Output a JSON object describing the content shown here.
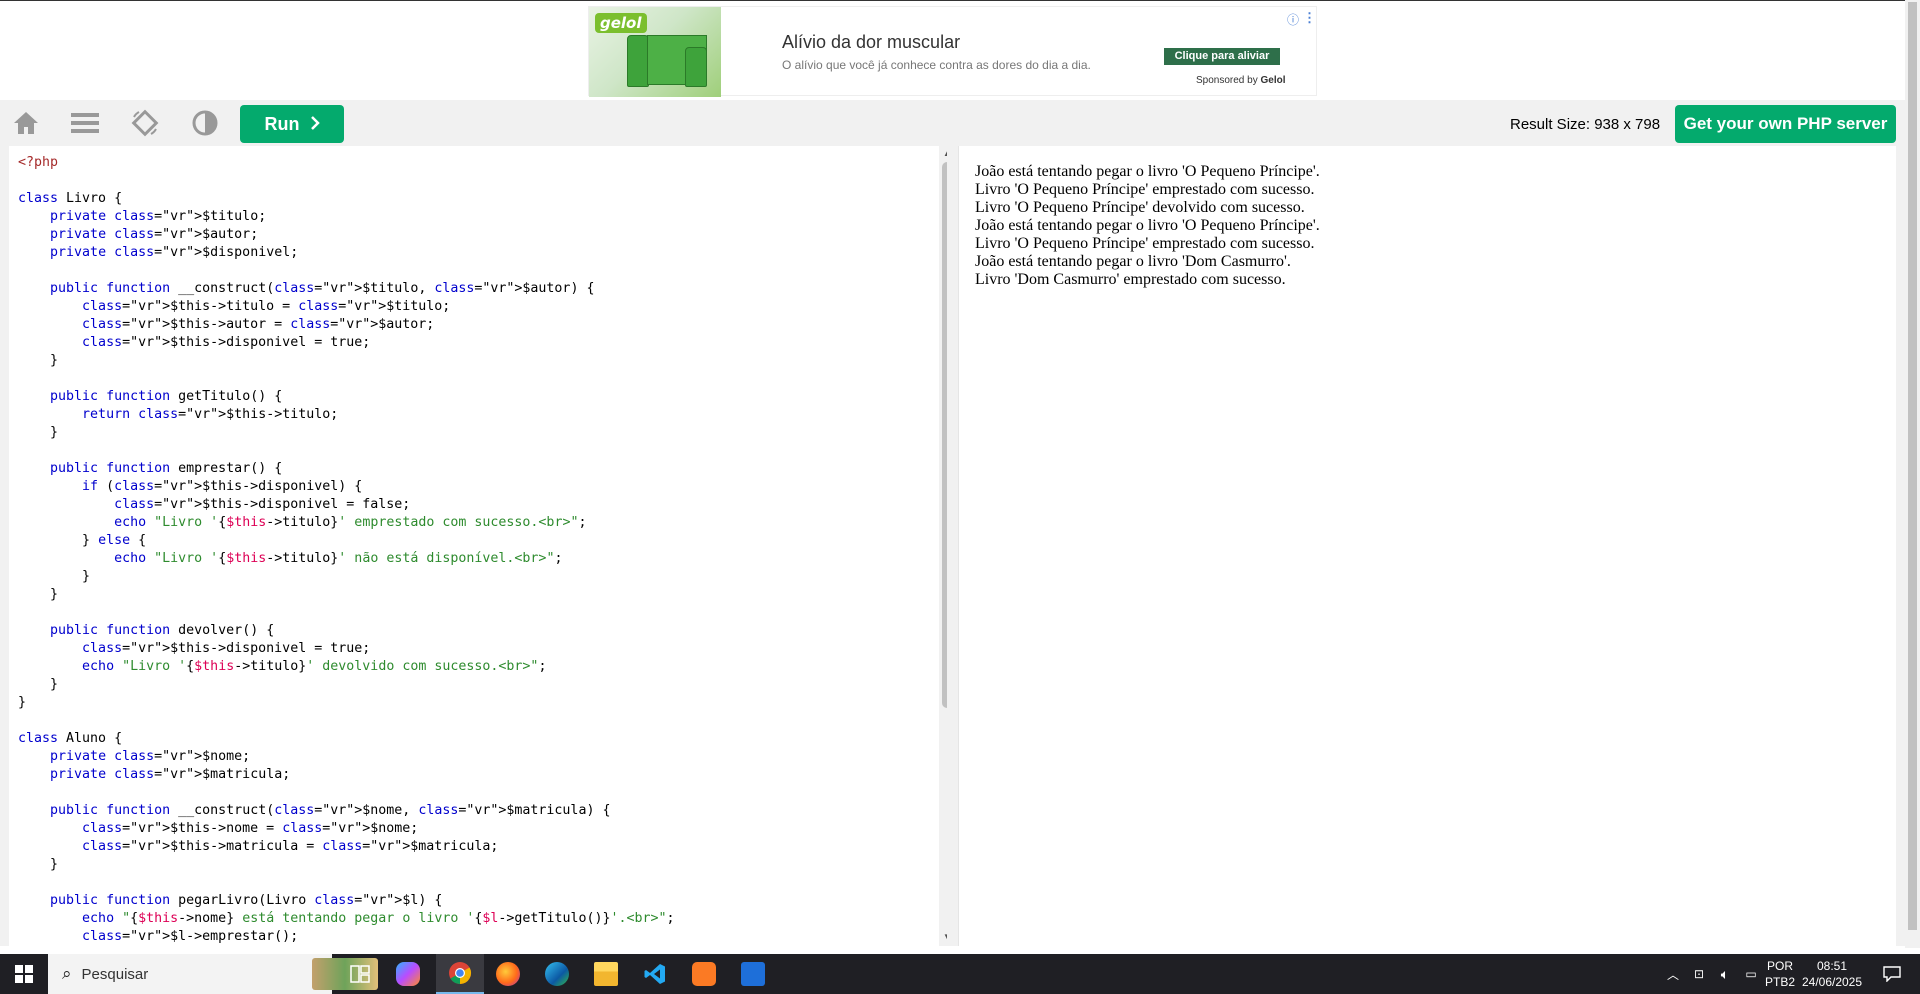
{
  "ad": {
    "brand": "gelol",
    "title": "Alívio da dor muscular",
    "subtitle": "O alívio que você já conhece contra as dores do dia a dia.",
    "cta": "Clique para aliviar",
    "sponsored_prefix": "Sponsored by",
    "sponsored_brand": "Gelol",
    "info_icon": "info-icon",
    "more_icon": "more-vertical-icon"
  },
  "toolbar": {
    "home_icon": "home-icon",
    "menu_icon": "menu-icon",
    "rotate_icon": "rotate-orientation-icon",
    "contrast_icon": "contrast-icon",
    "run_label": "Run",
    "result_size_label": "Result Size: 938 x 798",
    "own_server_label": "Get your own PHP server",
    "accent_color": "#04aa6d"
  },
  "editor": {
    "lines": [
      "<?php",
      "",
      "class Livro {",
      "    private $titulo;",
      "    private $autor;",
      "    private $disponivel;",
      "",
      "    public function __construct($titulo, $autor) {",
      "        $this->titulo = $titulo;",
      "        $this->autor = $autor;",
      "        $this->disponivel = true;",
      "    }",
      "",
      "    public function getTitulo() {",
      "        return $this->titulo;",
      "    }",
      "",
      "    public function emprestar() {",
      "        if ($this->disponivel) {",
      "            $this->disponivel = false;",
      "            echo \"Livro '{$this->titulo}' emprestado com sucesso.<br>\";",
      "        } else {",
      "            echo \"Livro '{$this->titulo}' não está disponível.<br>\";",
      "        }",
      "    }",
      "",
      "    public function devolver() {",
      "        $this->disponivel = true;",
      "        echo \"Livro '{$this->titulo}' devolvido com sucesso.<br>\";",
      "    }",
      "}",
      "",
      "class Aluno {",
      "    private $nome;",
      "    private $matricula;",
      "",
      "    public function __construct($nome, $matricula) {",
      "        $this->nome = $nome;",
      "        $this->matricula = $matricula;",
      "    }",
      "",
      "    public function pegarLivro(Livro $l) {",
      "        echo \"{$this->nome} está tentando pegar o livro '{$l->getTitulo()}'.<br>\";",
      "        $l->emprestar();"
    ]
  },
  "result": {
    "lines": [
      "João está tentando pegar o livro 'O Pequeno Príncipe'.",
      "Livro 'O Pequeno Príncipe' emprestado com sucesso.",
      "Livro 'O Pequeno Príncipe' devolvido com sucesso.",
      "João está tentando pegar o livro 'O Pequeno Príncipe'.",
      "Livro 'O Pequeno Príncipe' emprestado com sucesso.",
      "João está tentando pegar o livro 'Dom Casmurro'.",
      "Livro 'Dom Casmurro' emprestado com sucesso."
    ]
  },
  "taskbar": {
    "search_placeholder": "Pesquisar",
    "apps": [
      "start-icon",
      "task-view-icon",
      "copilot-icon",
      "chrome-icon",
      "firefox-icon",
      "edge-icon",
      "file-explorer-icon",
      "vscode-icon",
      "xampp-icon",
      "document-app-icon"
    ],
    "lang_top": "POR",
    "lang_bottom": "PTB2",
    "time": "08:51",
    "date": "24/06/2025"
  }
}
